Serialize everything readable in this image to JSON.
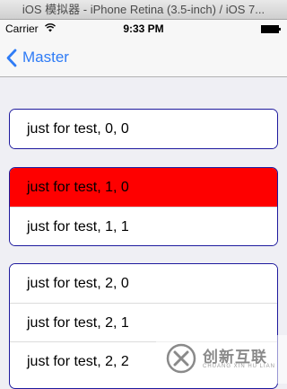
{
  "window": {
    "title": "iOS 模拟器 - iPhone Retina (3.5-inch) / iOS 7..."
  },
  "status_bar": {
    "carrier": "Carrier",
    "time": "9:33 PM"
  },
  "nav_bar": {
    "back_label": "Master"
  },
  "sections": [
    {
      "rows": [
        "just for test, 0, 0"
      ]
    },
    {
      "rows": [
        "just for test, 1, 0",
        "just for test, 1, 1"
      ],
      "selected_row": 0
    },
    {
      "rows": [
        "just for test, 2, 0",
        "just for test, 2, 1",
        "just for test, 2, 2"
      ]
    }
  ],
  "watermark": {
    "name": "创新互联",
    "subtitle": "CHUANG XIN HU LIAN"
  },
  "colors": {
    "tint": "#2f7cf6",
    "section_border": "#1e1a9e",
    "selected_row": "#fe0000",
    "background": "#efeff4"
  }
}
